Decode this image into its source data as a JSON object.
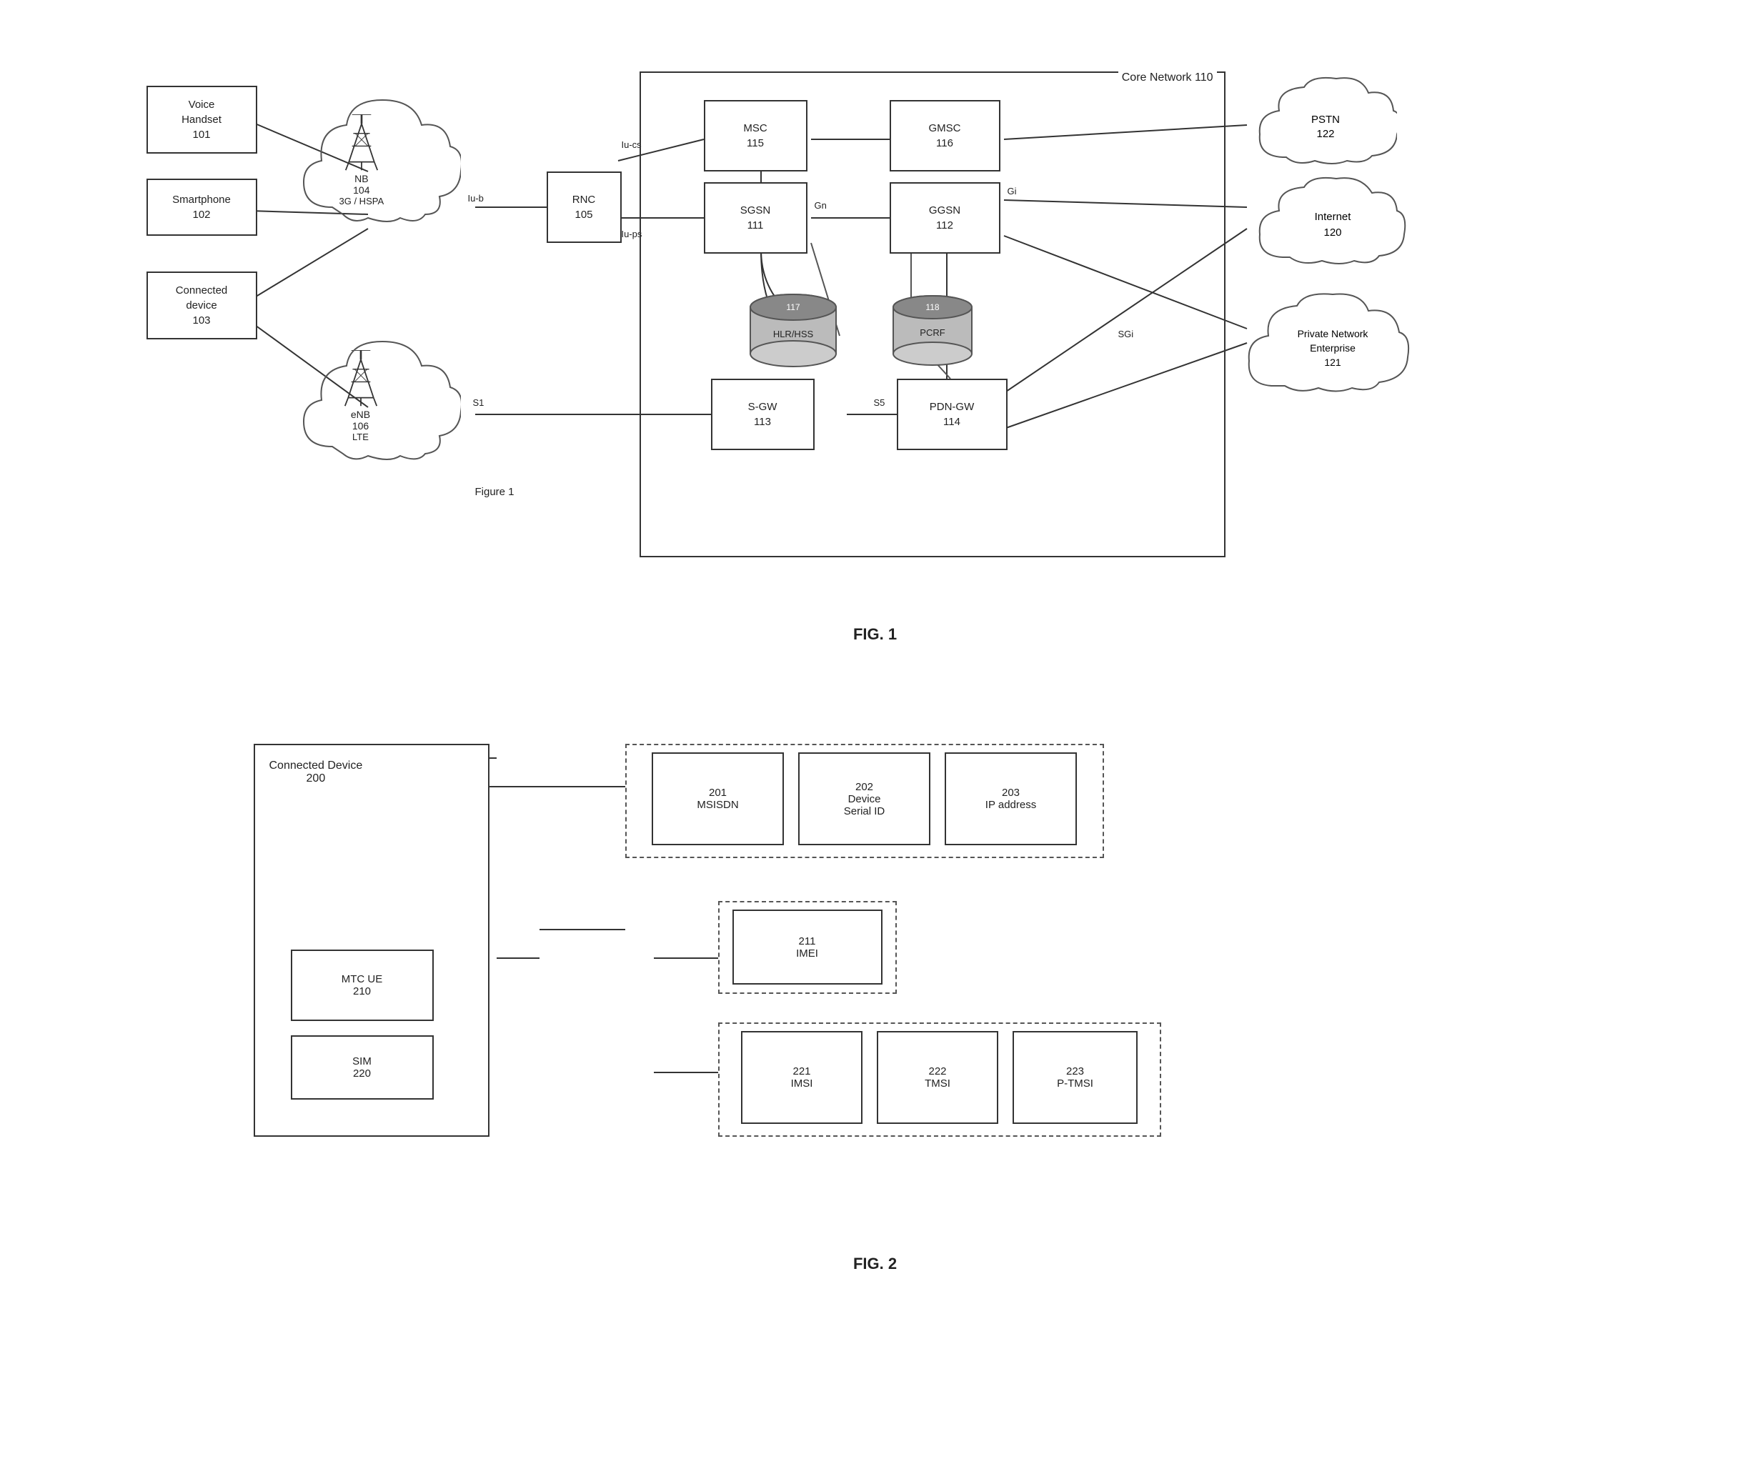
{
  "fig1": {
    "title": "FIG. 1",
    "figure_caption": "Figure 1",
    "core_network_label": "Core Network 110",
    "devices": [
      {
        "id": "voice-handset",
        "label": "Voice\nHandset\n101"
      },
      {
        "id": "smartphone",
        "label": "Smartphone\n102"
      },
      {
        "id": "connected-device",
        "label": "Connected\ndevice\n103"
      }
    ],
    "towers": [
      {
        "id": "nb",
        "label": "NB\n104",
        "sublabel": "3G / HSPA"
      },
      {
        "id": "enb",
        "label": "eNB\n106",
        "sublabel": "LTE"
      }
    ],
    "nodes": [
      {
        "id": "rnc",
        "label": "RNC\n105"
      },
      {
        "id": "msc",
        "label": "MSC\n115"
      },
      {
        "id": "gmsc",
        "label": "GMSC\n116"
      },
      {
        "id": "sgsn",
        "label": "SGSN\n111"
      },
      {
        "id": "ggsn",
        "label": "GGSN\n112"
      },
      {
        "id": "sgw",
        "label": "S-GW\n113"
      },
      {
        "id": "pdngw",
        "label": "PDN-GW\n114"
      }
    ],
    "databases": [
      {
        "id": "hlrhss",
        "label": "HLR/HSS",
        "num": "117"
      },
      {
        "id": "pcrf",
        "label": "PCRF",
        "num": "118"
      }
    ],
    "external": [
      {
        "id": "pstn",
        "label": "PSTN\n122"
      },
      {
        "id": "internet",
        "label": "Internet\n120"
      },
      {
        "id": "private-network",
        "label": "Private Network\nEnterprise\n121"
      }
    ],
    "interfaces": [
      "Iu-b",
      "Iu-cs",
      "Iu-ps",
      "Gn",
      "Gi",
      "SGi",
      "S1",
      "S5"
    ]
  },
  "fig2": {
    "title": "FIG. 2",
    "connected_device": {
      "label": "Connected Device",
      "num": "200"
    },
    "mtc_ue": {
      "label": "MTC UE",
      "num": "210"
    },
    "sim": {
      "label": "SIM",
      "num": "220"
    },
    "identifiers_top": [
      {
        "num": "201",
        "label": "MSISDN"
      },
      {
        "num": "202",
        "label": "Device\nSerial ID"
      },
      {
        "num": "203",
        "label": "IP address"
      }
    ],
    "identifier_mid": {
      "num": "211",
      "label": "IMEI"
    },
    "identifiers_bot": [
      {
        "num": "221",
        "label": "IMSI"
      },
      {
        "num": "222",
        "label": "TMSI"
      },
      {
        "num": "223",
        "label": "P-TMSI"
      }
    ]
  }
}
